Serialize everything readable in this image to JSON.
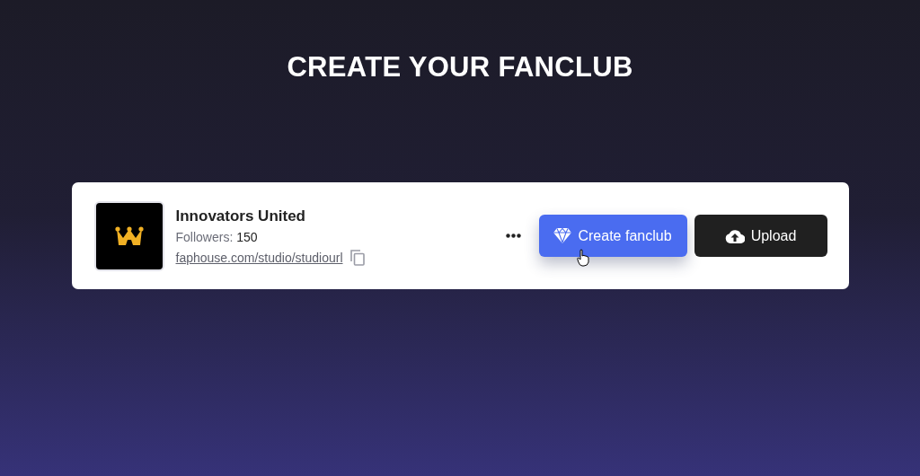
{
  "heading": "CREATE YOUR FANCLUB",
  "studio": {
    "name": "Innovators United",
    "followers_label": "Followers:",
    "followers": "150",
    "url": "faphouse.com/studio/studiourl"
  },
  "buttons": [
    {
      "kind": "primary",
      "label": "Create fanclub",
      "hovered": true
    },
    {
      "kind": "dark",
      "label": "Upload",
      "hovered": false
    }
  ]
}
